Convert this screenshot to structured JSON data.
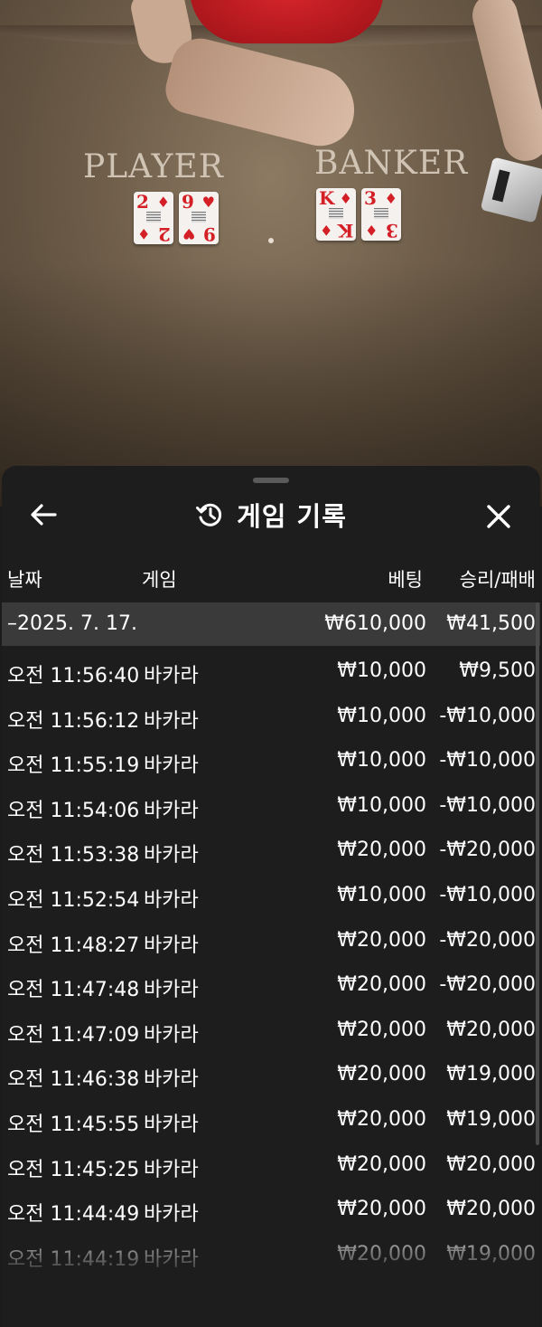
{
  "table": {
    "player_label": "PLAYER",
    "banker_label": "BANKER",
    "player_cards": [
      {
        "rank": "2",
        "suit": "♦"
      },
      {
        "rank": "9",
        "suit": "♥"
      }
    ],
    "banker_cards": [
      {
        "rank": "K",
        "suit": "♦"
      },
      {
        "rank": "3",
        "suit": "♦"
      }
    ]
  },
  "sheet": {
    "title": "게임 기록",
    "back_icon": "arrow-left-icon",
    "history_icon": "history-icon",
    "close_icon": "close-icon"
  },
  "columns": {
    "date": "날짜",
    "game": "게임",
    "bet": "베팅",
    "result": "승리/패배"
  },
  "group": {
    "date": "–2025. 7. 17.",
    "bet_total": "₩610,000",
    "result_total": "₩41,500"
  },
  "rows": [
    {
      "time": "오전 11:56:40",
      "game": "바카라",
      "bet": "₩10,000",
      "result": "₩9,500"
    },
    {
      "time": "오전 11:56:12",
      "game": "바카라",
      "bet": "₩10,000",
      "result": "-₩10,000"
    },
    {
      "time": "오전 11:55:19",
      "game": "바카라",
      "bet": "₩10,000",
      "result": "-₩10,000"
    },
    {
      "time": "오전 11:54:06",
      "game": "바카라",
      "bet": "₩10,000",
      "result": "-₩10,000"
    },
    {
      "time": "오전 11:53:38",
      "game": "바카라",
      "bet": "₩20,000",
      "result": "-₩20,000"
    },
    {
      "time": "오전 11:52:54",
      "game": "바카라",
      "bet": "₩10,000",
      "result": "-₩10,000"
    },
    {
      "time": "오전 11:48:27",
      "game": "바카라",
      "bet": "₩20,000",
      "result": "-₩20,000"
    },
    {
      "time": "오전 11:47:48",
      "game": "바카라",
      "bet": "₩20,000",
      "result": "-₩20,000"
    },
    {
      "time": "오전 11:47:09",
      "game": "바카라",
      "bet": "₩20,000",
      "result": "₩20,000"
    },
    {
      "time": "오전 11:46:38",
      "game": "바카라",
      "bet": "₩20,000",
      "result": "₩19,000"
    },
    {
      "time": "오전 11:45:55",
      "game": "바카라",
      "bet": "₩20,000",
      "result": "₩19,000"
    },
    {
      "time": "오전 11:45:25",
      "game": "바카라",
      "bet": "₩20,000",
      "result": "₩20,000"
    },
    {
      "time": "오전 11:44:49",
      "game": "바카라",
      "bet": "₩20,000",
      "result": "₩20,000"
    },
    {
      "time": "오전 11:44:19",
      "game": "바카라",
      "bet": "₩20,000",
      "result": "₩19,000"
    }
  ]
}
